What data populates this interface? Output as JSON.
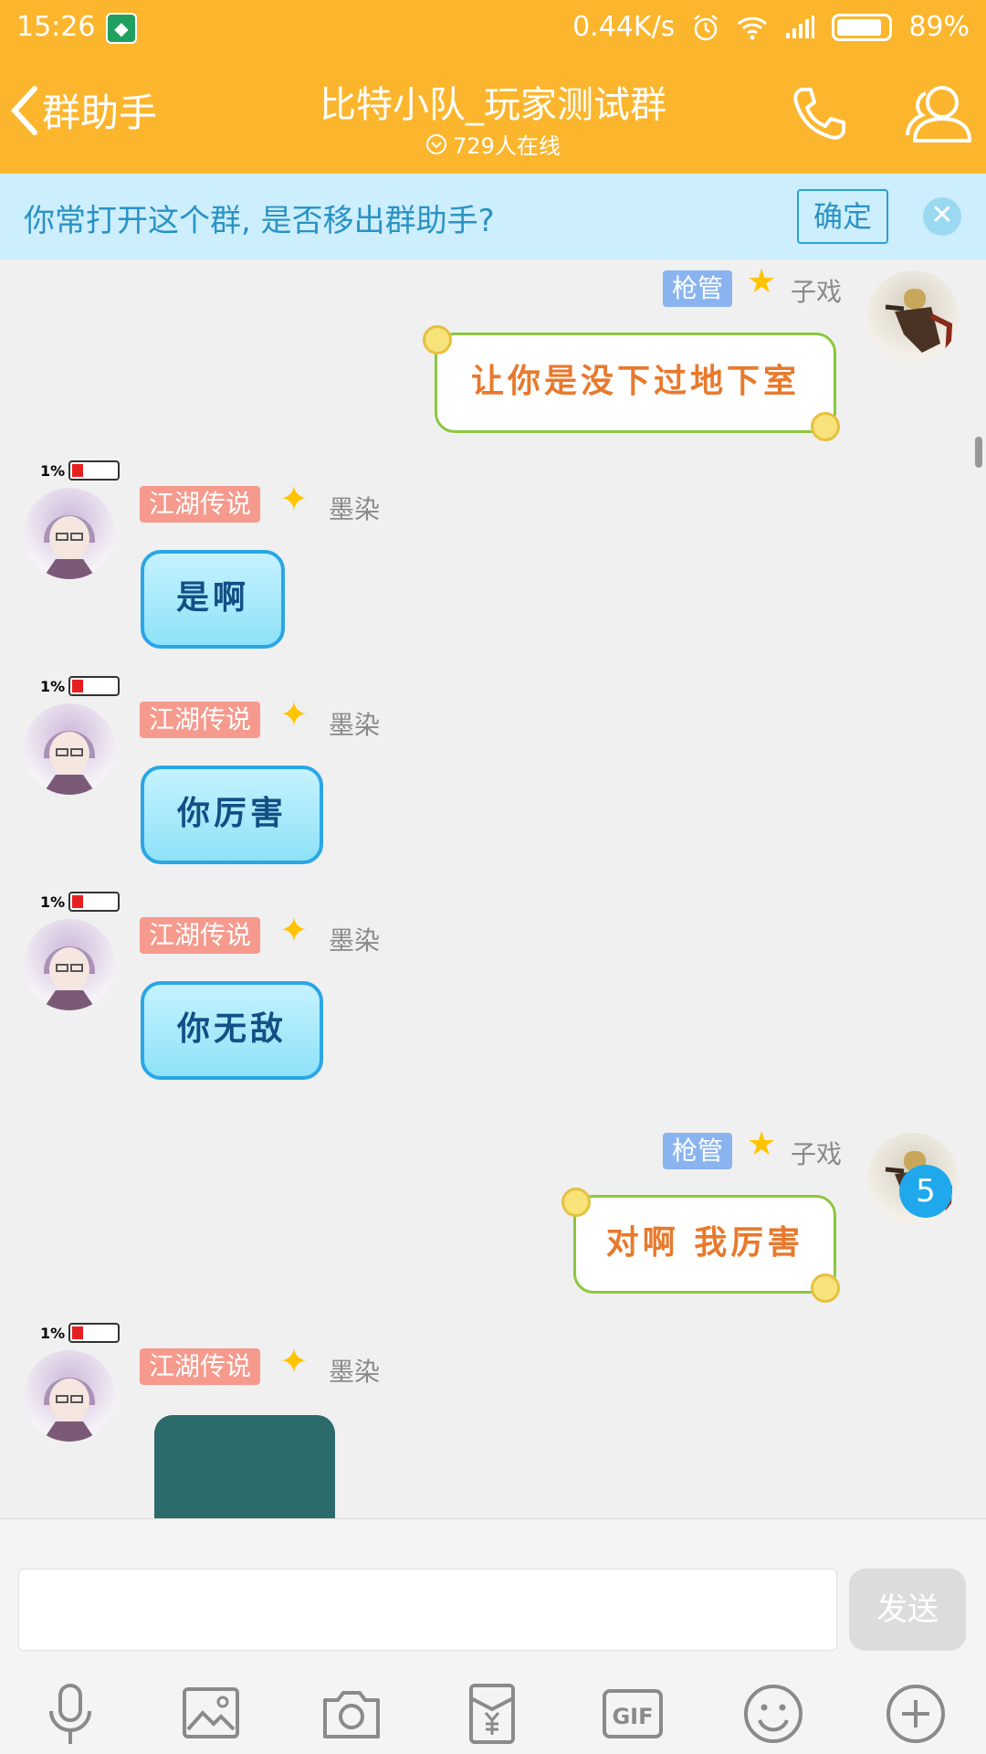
{
  "status_bar": {
    "time": "15:26",
    "net_speed": "0.44K/s",
    "battery_percent": "89%",
    "battery_level": 0.89
  },
  "header": {
    "back_label": "群助手",
    "title": "比特小队_玩家测试群",
    "online": "729人在线"
  },
  "banner": {
    "text": "你常打开这个群, 是否移出群助手?",
    "confirm": "确定"
  },
  "messages": [
    {
      "side": "right",
      "tag": "枪管",
      "nick": "子戏",
      "text": "让你是没下过地下室"
    },
    {
      "side": "left",
      "tag": "江湖传说",
      "nick": "墨染",
      "battery": "1%",
      "text": "是啊"
    },
    {
      "side": "left",
      "tag": "江湖传说",
      "nick": "墨染",
      "battery": "1%",
      "text": "你厉害"
    },
    {
      "side": "left",
      "tag": "江湖传说",
      "nick": "墨染",
      "battery": "1%",
      "text": "你无敌"
    },
    {
      "side": "right",
      "tag": "枪管",
      "nick": "子戏",
      "text": "对啊 我厉害"
    },
    {
      "side": "left",
      "tag": "江湖传说",
      "nick": "墨染",
      "battery": "1%",
      "text": ""
    }
  ],
  "unread_badge": "5",
  "input": {
    "send": "发送"
  },
  "icons": [
    "mic-icon",
    "image-icon",
    "camera-icon",
    "red-packet-icon",
    "gif-icon",
    "emoji-icon",
    "plus-icon"
  ],
  "colors": {
    "accent": "#fbb62e",
    "banner_bg": "#cdeefc",
    "badge": "#1fa9ec"
  }
}
